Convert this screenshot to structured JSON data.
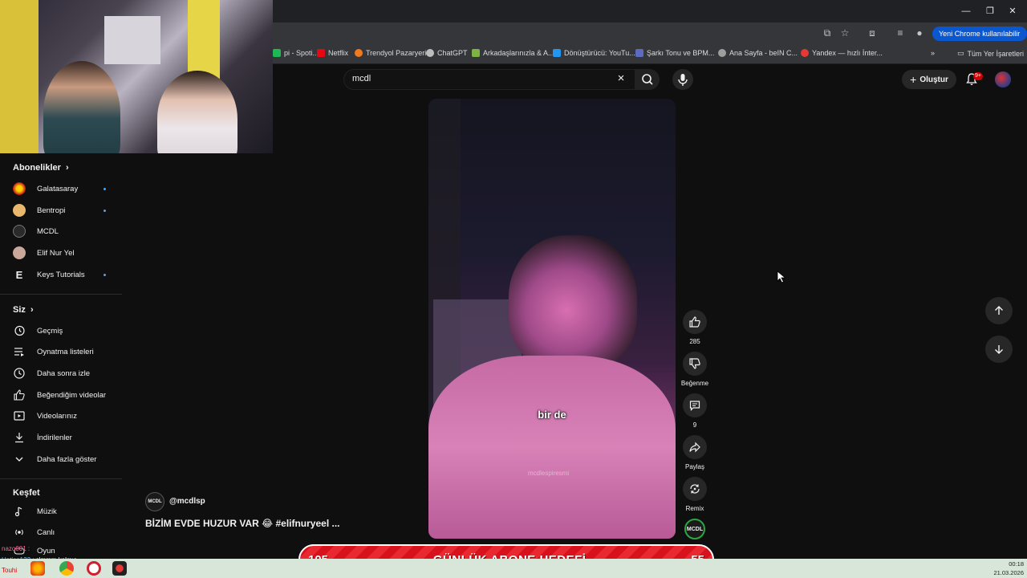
{
  "browser": {
    "new_chrome_label": "Yeni Chrome kullanılabilir",
    "bookmarks": [
      {
        "label": "pi - Spoti...",
        "color": "#1db954"
      },
      {
        "label": "Netflix",
        "color": "#e50914"
      },
      {
        "label": "Trendyol Pazaryeri",
        "color": "#f27a1a"
      },
      {
        "label": "ChatGPT",
        "color": "#bdbdbd"
      },
      {
        "label": "Arkadaşlarınızla & A...",
        "color": "#7cb342"
      },
      {
        "label": "Dönüştürücü: YouTu...",
        "color": "#2196f3"
      },
      {
        "label": "Şarkı Tonu ve BPM...",
        "color": "#5c6bc0"
      },
      {
        "label": "Ana Sayfa - beIN C...",
        "color": "#9e9e9e"
      },
      {
        "label": "Yandex — hızlı İnter...",
        "color": "#e53935"
      }
    ],
    "all_bookmarks_label": "Tüm Yer İşaretleri"
  },
  "header": {
    "search_value": "mcdl",
    "create_label": "Oluştur",
    "notification_badge": "9+"
  },
  "sidebar": {
    "subscriptions_heading": "Abonelikler",
    "subscriptions": [
      {
        "label": "Galatasaray",
        "color": "#f5a623",
        "new": true
      },
      {
        "label": "Bentropi",
        "color": "#e8b86d",
        "new": true
      },
      {
        "label": "MCDL",
        "color": "#2a2a2a",
        "new": false
      },
      {
        "label": "Elif Nur Yel",
        "color": "#c9a89a",
        "new": false
      },
      {
        "label": "Keys Tutorials",
        "color": "#0f0f0f",
        "new": true
      }
    ],
    "you_heading": "Siz",
    "you_items": [
      {
        "label": "Geçmiş",
        "icon": "history-icon"
      },
      {
        "label": "Oynatma listeleri",
        "icon": "playlist-icon"
      },
      {
        "label": "Daha sonra izle",
        "icon": "clock-icon"
      },
      {
        "label": "Beğendiğim videolar",
        "icon": "thumb-up-icon"
      },
      {
        "label": "Videolarınız",
        "icon": "video-icon"
      },
      {
        "label": "İndirilenler",
        "icon": "download-icon"
      },
      {
        "label": "Daha fazla göster",
        "icon": "chevron-down-icon"
      }
    ],
    "explore_heading": "Keşfet",
    "explore_items": [
      {
        "label": "Müzik",
        "icon": "music-icon"
      },
      {
        "label": "Canlı",
        "icon": "live-icon"
      },
      {
        "label": "Oyun",
        "icon": "gaming-icon"
      }
    ]
  },
  "short": {
    "caption": "bir de",
    "watermark": "mcdlespiresmi",
    "channel_handle": "@mcdlsp",
    "channel_badge": "MCDL",
    "title": "BİZİM EVDE HUZUR VAR 😂 #elifnuryeel ...",
    "likes": "285",
    "dislike_label": "Beğenme",
    "comments": "9",
    "share_label": "Paylaş",
    "remix_label": "Remix"
  },
  "overlay": {
    "goal_left": "105",
    "goal_title": "GÜNLÜK ABONE HEDEFİ",
    "goal_right": "55",
    "chat_user": "nazo001 :",
    "chat_line2": "Hatice123 :",
    "chat_line2_msg": "slmmm kalmış",
    "chat_line3": "Touhi"
  },
  "taskbar": {
    "time": "00:18",
    "date": "21.03.2026"
  }
}
